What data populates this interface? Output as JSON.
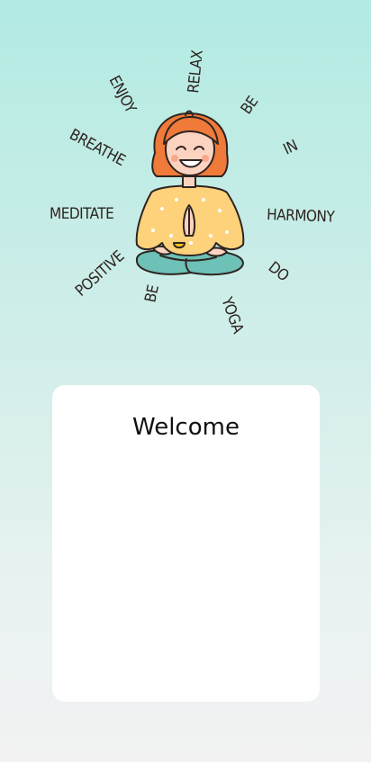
{
  "illustration": {
    "words": {
      "enjoy": "ENJOY",
      "relax": "RELAX",
      "be_top": "BE",
      "breathe": "BREATHE",
      "in": "IN",
      "meditate": "MEDITATE",
      "harmony": "HARMONY",
      "positive": "POSITIVE",
      "do": "DO",
      "be_bottom": "BE",
      "yoga": "YOGA"
    }
  },
  "card": {
    "title": "Welcome"
  },
  "colors": {
    "hair": "#ef7a3a",
    "skin": "#fcd3c0",
    "sweater": "#fdd27a",
    "pants": "#6dc1b7",
    "outline": "#2e2420"
  }
}
